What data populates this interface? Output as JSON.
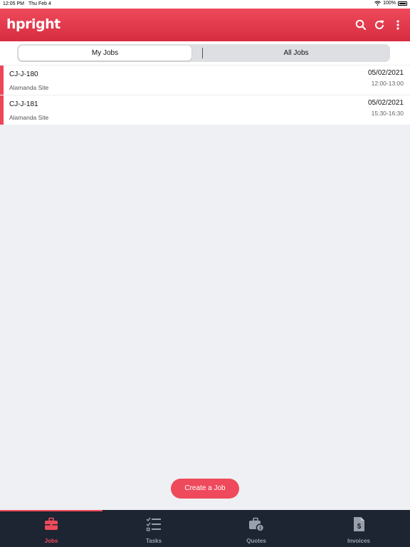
{
  "status_bar": {
    "time": "12:05 PM",
    "date": "Thu Feb 4",
    "battery": "100%"
  },
  "header": {
    "logo": "hpright",
    "actions": [
      "search-icon",
      "refresh-icon",
      "more-icon"
    ]
  },
  "segments": {
    "my_jobs": "My Jobs",
    "all_jobs": "All Jobs",
    "selected": "My Jobs"
  },
  "jobs": [
    {
      "code": "CJ-J-180",
      "site": "Alamanda Site",
      "date": "05/02/2021",
      "time": "12:00-13:00"
    },
    {
      "code": "CJ-J-181",
      "site": "Alamanda Site",
      "date": "05/02/2021",
      "time": "15:30-16:30"
    }
  ],
  "create_button": "Create a Job",
  "tabs": [
    {
      "label": "Jobs",
      "icon": "briefcase-icon",
      "active": true
    },
    {
      "label": "Tasks",
      "icon": "checklist-icon",
      "active": false
    },
    {
      "label": "Quotes",
      "icon": "quote-icon",
      "active": false
    },
    {
      "label": "Invoices",
      "icon": "invoice-icon",
      "active": false
    }
  ],
  "colors": {
    "accent": "#ee4a5b",
    "tab_bar": "#1d2432",
    "background": "#eef0f3"
  }
}
